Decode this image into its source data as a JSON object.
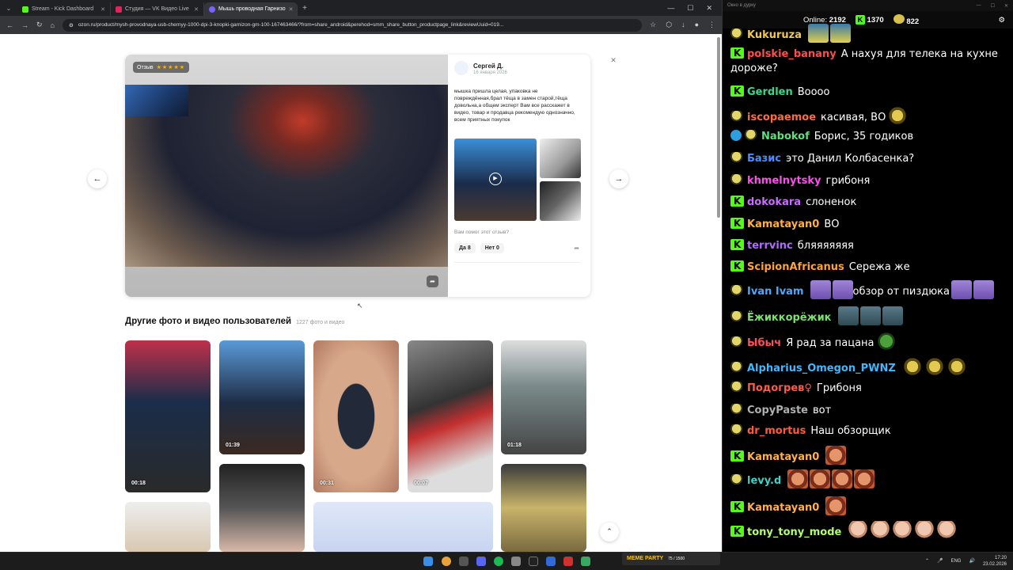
{
  "browser": {
    "tabs": [
      {
        "label": "Stream - Kick Dashboard",
        "color": "#53fc18"
      },
      {
        "label": "Студия — VK Видео Live",
        "color": "#e0245e"
      },
      {
        "label": "Мышь проводная Гарнизо",
        "color": "#7b61ff",
        "active": true
      }
    ],
    "url": "ozon.ru/product/mysh-provodnaya-usb-chernyy-1000-dpi-3-knopki-garnizon-gm-100-167463466/?from=share_android&perehod=smm_share_button_productpage_link&reviewUuid=019..."
  },
  "review": {
    "badge": "Отзыв",
    "stars": "★★★★★",
    "author": "Сергей Д.",
    "date": "16 января 2026",
    "text": "мышка пришла целая, упаковка не повреждённая,брал тёща в замен старой,тёща довольна,а общем эксперт Вам все расскажет в видео, товар и продавца рекомендую однозначно, всем приятных покупок",
    "helpful_question": "Вам помог этот отзыв?",
    "yes": "Да 8",
    "no": "Нет 0"
  },
  "gallery": {
    "title": "Другие фото и видео пользователей",
    "count": "1227 фото и видео",
    "durations": [
      "00:18",
      "01:39",
      "00:31",
      "00:07",
      "01:18"
    ]
  },
  "chat": {
    "window_title": "Окно в дурку",
    "online_label": "Online:",
    "online": "2192",
    "kick_count": "1370",
    "other_count": "822",
    "messages": [
      {
        "user": "Kukuruza",
        "color": "#f3c84a",
        "badge": "p",
        "text": ""
      },
      {
        "user": "polskie_banany",
        "color": "#ff4d4d",
        "badge": "k",
        "text": "А нахуя для телека на кухне дороже?"
      },
      {
        "user": "Gerdlen",
        "color": "#39d98a",
        "badge": "k",
        "text": "Boooo"
      },
      {
        "user": "iscopaemoe",
        "color": "#ff6b3b",
        "badge": "p",
        "text": "касивая, ВО"
      },
      {
        "user": "Nabokof",
        "color": "#5ee07a",
        "badge": "vp",
        "text": "Борис, 35 годиков"
      },
      {
        "user": "Базис",
        "color": "#4a8cff",
        "badge": "p",
        "text": "это Данил Колбасенка?"
      },
      {
        "user": "khmelnytsky",
        "color": "#ff4df0",
        "badge": "p",
        "text": "грибоня"
      },
      {
        "user": "dokokara",
        "color": "#c86cff",
        "badge": "k",
        "text": "слоненок"
      },
      {
        "user": "Kamatayan0",
        "color": "#ffb04a",
        "badge": "k",
        "text": "ВО"
      },
      {
        "user": "terrvinc",
        "color": "#b06bff",
        "badge": "k",
        "text": "бляяяяяяя"
      },
      {
        "user": "ScipionAfricanus",
        "color": "#ffa23a",
        "badge": "k",
        "text": "Сережа же"
      },
      {
        "user": "Ivan Ivam",
        "color": "#4aa8ff",
        "badge": "p",
        "text": "обзор от пиздюка"
      },
      {
        "user": "Ёжиккорёжик",
        "color": "#7ee070",
        "badge": "p",
        "text": ""
      },
      {
        "user": "Ыбыч",
        "color": "#ff4d5a",
        "badge": "p",
        "text": "Я рад за пацана"
      },
      {
        "user": "Alpharius_Omegon_PWNZ",
        "color": "#3fb8ff",
        "badge": "p",
        "text": ""
      },
      {
        "user": "Подогрев♀",
        "color": "#ff5a4a",
        "badge": "p",
        "text": "Грибоня"
      },
      {
        "user": "CopyPaste",
        "color": "#b0b0b0",
        "badge": "p",
        "text": "вот"
      },
      {
        "user": "dr_mortus",
        "color": "#ff5a3a",
        "badge": "p",
        "text": "Наш обзорщик"
      },
      {
        "user": "Kamatayan0",
        "color": "#ffb04a",
        "badge": "k",
        "text": ""
      },
      {
        "user": "levy.d",
        "color": "#3fd0c8",
        "badge": "p",
        "text": ""
      },
      {
        "user": "Kamatayan0",
        "color": "#ffb04a",
        "badge": "k",
        "text": ""
      },
      {
        "user": "tony_tony_mode",
        "color": "#b0ff6a",
        "badge": "k",
        "text": ""
      }
    ]
  },
  "taskbar": {
    "meme_party": "MEME PARTY",
    "meme_count": "75 / 1500",
    "lang": "ENG",
    "time": "17:20",
    "date": "23.02.2026"
  }
}
